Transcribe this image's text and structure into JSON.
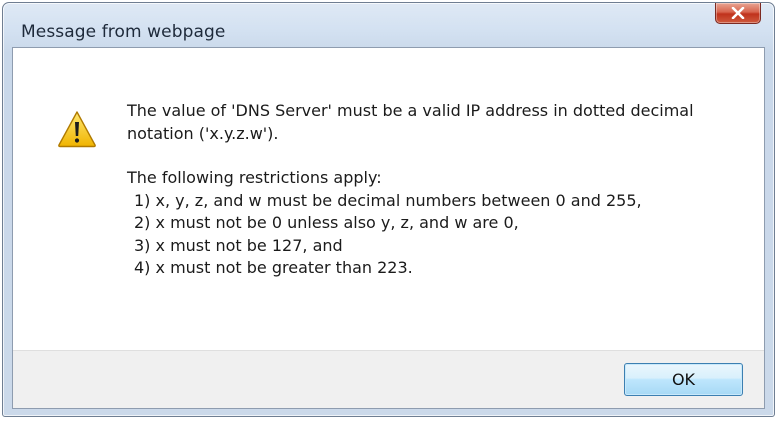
{
  "dialog": {
    "title": "Message from webpage",
    "close_icon": "close-icon",
    "warning_icon": "warning-icon",
    "message_line1": "The value of 'DNS Server' must be a valid IP address in dotted decimal",
    "message_line2": "notation ('x.y.z.w').",
    "restrictions_header": "The following restrictions apply:",
    "restrictions": [
      "1) x, y, z, and w must be decimal numbers between 0 and 255,",
      "2) x must not be 0 unless also y, z, and w are 0,",
      "3) x must not be 127, and",
      "4) x must not be greater than 223."
    ],
    "ok_label": "OK"
  },
  "colors": {
    "close_button": "#c7402a",
    "ok_button_border": "#3c7fb1",
    "warning_fill": "#f5c400"
  }
}
